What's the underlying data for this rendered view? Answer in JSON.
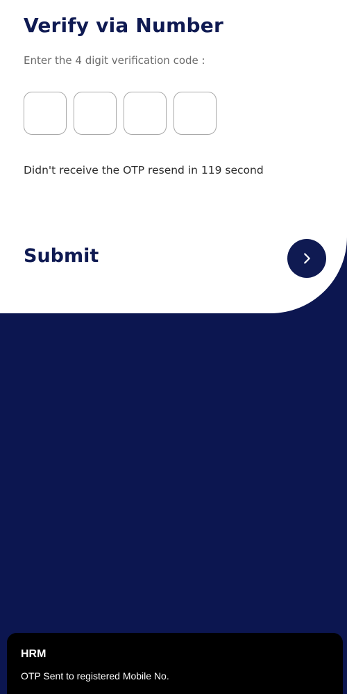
{
  "header": {
    "title": "Verify via Number"
  },
  "otp": {
    "instruction": "Enter the 4 digit verification code :",
    "digits": [
      "",
      "",
      "",
      ""
    ],
    "resend_text": "Didn't receive the OTP resend in 119 second"
  },
  "submit": {
    "label": "Submit",
    "icon": "chevron-right-icon"
  },
  "toast": {
    "title": "HRM",
    "message": "OTP Sent to registered Mobile No."
  },
  "colors": {
    "primary": "#0f1a52",
    "background": "#0c1650",
    "card": "#ffffff",
    "toast": "#000000"
  }
}
